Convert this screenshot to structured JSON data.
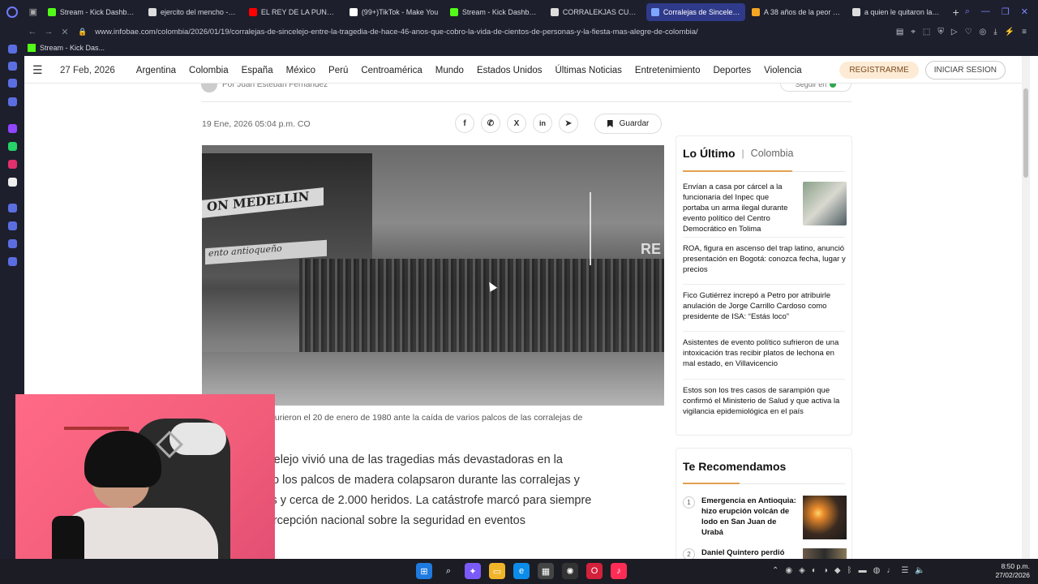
{
  "browser": {
    "tabs": [
      {
        "label": "Stream - Kick Dashboard",
        "color": "#53fc18",
        "active": false
      },
      {
        "label": "ejercito del mencho - Bu",
        "color": "#dddddd",
        "active": false
      },
      {
        "label": "EL REY DE LA PUNTUAL",
        "color": "#ff0000",
        "active": false
      },
      {
        "label": "(99+)TikTok - Make You",
        "color": "#ffffff",
        "active": false
      },
      {
        "label": "Stream - Kick Dashboard",
        "color": "#53fc18",
        "active": false
      },
      {
        "label": "CORRALEKJAS CUANDO",
        "color": "#dddddd",
        "active": false
      },
      {
        "label": "Corralejas de Sincelejo, en",
        "color": "#7da7ff",
        "active": true
      },
      {
        "label": "A 38 años de la peor tra",
        "color": "#f5a623",
        "active": false
      },
      {
        "label": "a quien le quitaron la cor",
        "color": "#dddddd",
        "active": false
      }
    ],
    "url": "www.infobae.com/colombia/2026/01/19/corralejas-de-sincelejo-entre-la-tragedia-de-hace-46-anos-que-cobro-la-vida-de-cientos-de-personas-y-la-fiesta-mas-alegre-de-colombia/",
    "bookmark": "Stream - Kick Das..."
  },
  "site": {
    "date": "27 Feb, 2026",
    "categories": [
      "Argentina",
      "Colombia",
      "España",
      "México",
      "Perú",
      "Centroamérica",
      "Mundo",
      "Estados Unidos",
      "Últimas Noticias",
      "Entretenimiento",
      "Deportes",
      "Violencia"
    ],
    "register": "REGISTRARME",
    "login": "INICIAR SESION"
  },
  "article": {
    "author_prefix": "Por",
    "author": "Juan Esteban Fernández",
    "follow": "Seguir en",
    "pubdate": "19 Ene, 2026 05:04 p.m. CO",
    "save": "Guardar",
    "image_text_1": "ON MEDELLIN",
    "image_text_2": "ento   antioqueño",
    "image_text_3": "RE",
    "caption": "de 500 personas murieron el 20 de enero de 1980 ante la caída de varios palcos de las corralejas de\nlcaldía de Sincelejo",
    "body": "de 1980, Sincelejo vivió una de las tragedias más devastadoras en la\nombia, cuando los palcos de madera colapsaron durante las corralejas y\ne 500 muertos y cerca de 2.000 heridos. La catástrofe marcó para siempre\nnsformó la percepción nacional sobre la seguridad en eventos\ns."
  },
  "sidebar": {
    "lo_ultimo": "Lo Último",
    "region": "Colombia",
    "news": [
      "Envían a casa por cárcel a la funcionaria del Inpec que portaba un arma ilegal durante evento político del Centro Democrático en Tolima",
      "ROA, figura en ascenso del trap latino, anunció presentación en Bogotá: conozca fecha, lugar y precios",
      "Fico Gutiérrez increpó a Petro por atribuirle anulación de Jorge Carrillo Cardoso como presidente de ISA: “Estás loco”",
      "Asistentes de evento político sufrieron de una intoxicación tras recibir platos de lechona en mal estado, en Villavicencio",
      "Estos son los tres casos de sarampión que confirmó el Ministerio de Salud y que activa la vigilancia epidemiológica en el país"
    ],
    "recommend_title": "Te Recomendamos",
    "recommend": [
      {
        "num": "1",
        "title": "Emergencia en Antioquia: hizo erupción volcán de lodo en San Juan de Urabá"
      },
      {
        "num": "2",
        "title": "Daniel Quintero perdió"
      }
    ]
  },
  "taskbar": {
    "time": "8:50 p.m.",
    "date": "27/02/2026"
  }
}
